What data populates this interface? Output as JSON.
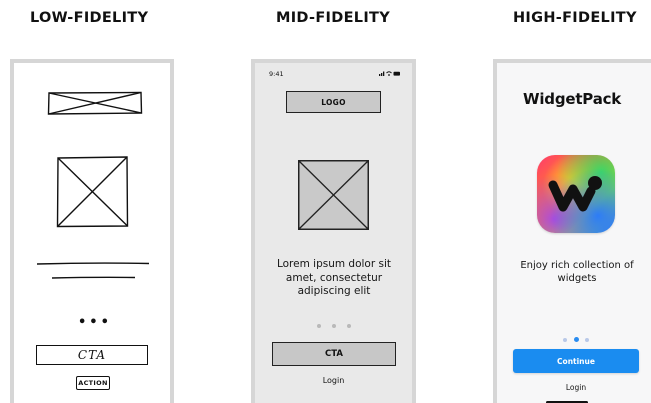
{
  "headings": {
    "low": "LOW-FIDELITY",
    "mid": "MID-FIDELITY",
    "high": "HIGH-FIDELITY"
  },
  "low_fidelity": {
    "cta_label": "CTA",
    "action_label": "ACTION",
    "dots": "•••"
  },
  "mid_fidelity": {
    "status_time": "9:41",
    "logo_label": "LOGO",
    "body_text": "Lorem ipsum dolor sit amet, consectetur adipiscing elit",
    "cta_label": "CTA",
    "login_label": "Login"
  },
  "high_fidelity": {
    "app_name": "WidgetPack",
    "tagline": "Enjoy rich collection of widgets",
    "continue_label": "Continue",
    "login_label": "Login",
    "accent_color": "#1a8cf0"
  },
  "icons": {
    "wireframe_banner": "crossed-box-icon",
    "wireframe_image": "image-placeholder-icon",
    "status_bar": "signal-wifi-battery-icon",
    "app_icon": "widgetpack-w-logo-icon"
  }
}
